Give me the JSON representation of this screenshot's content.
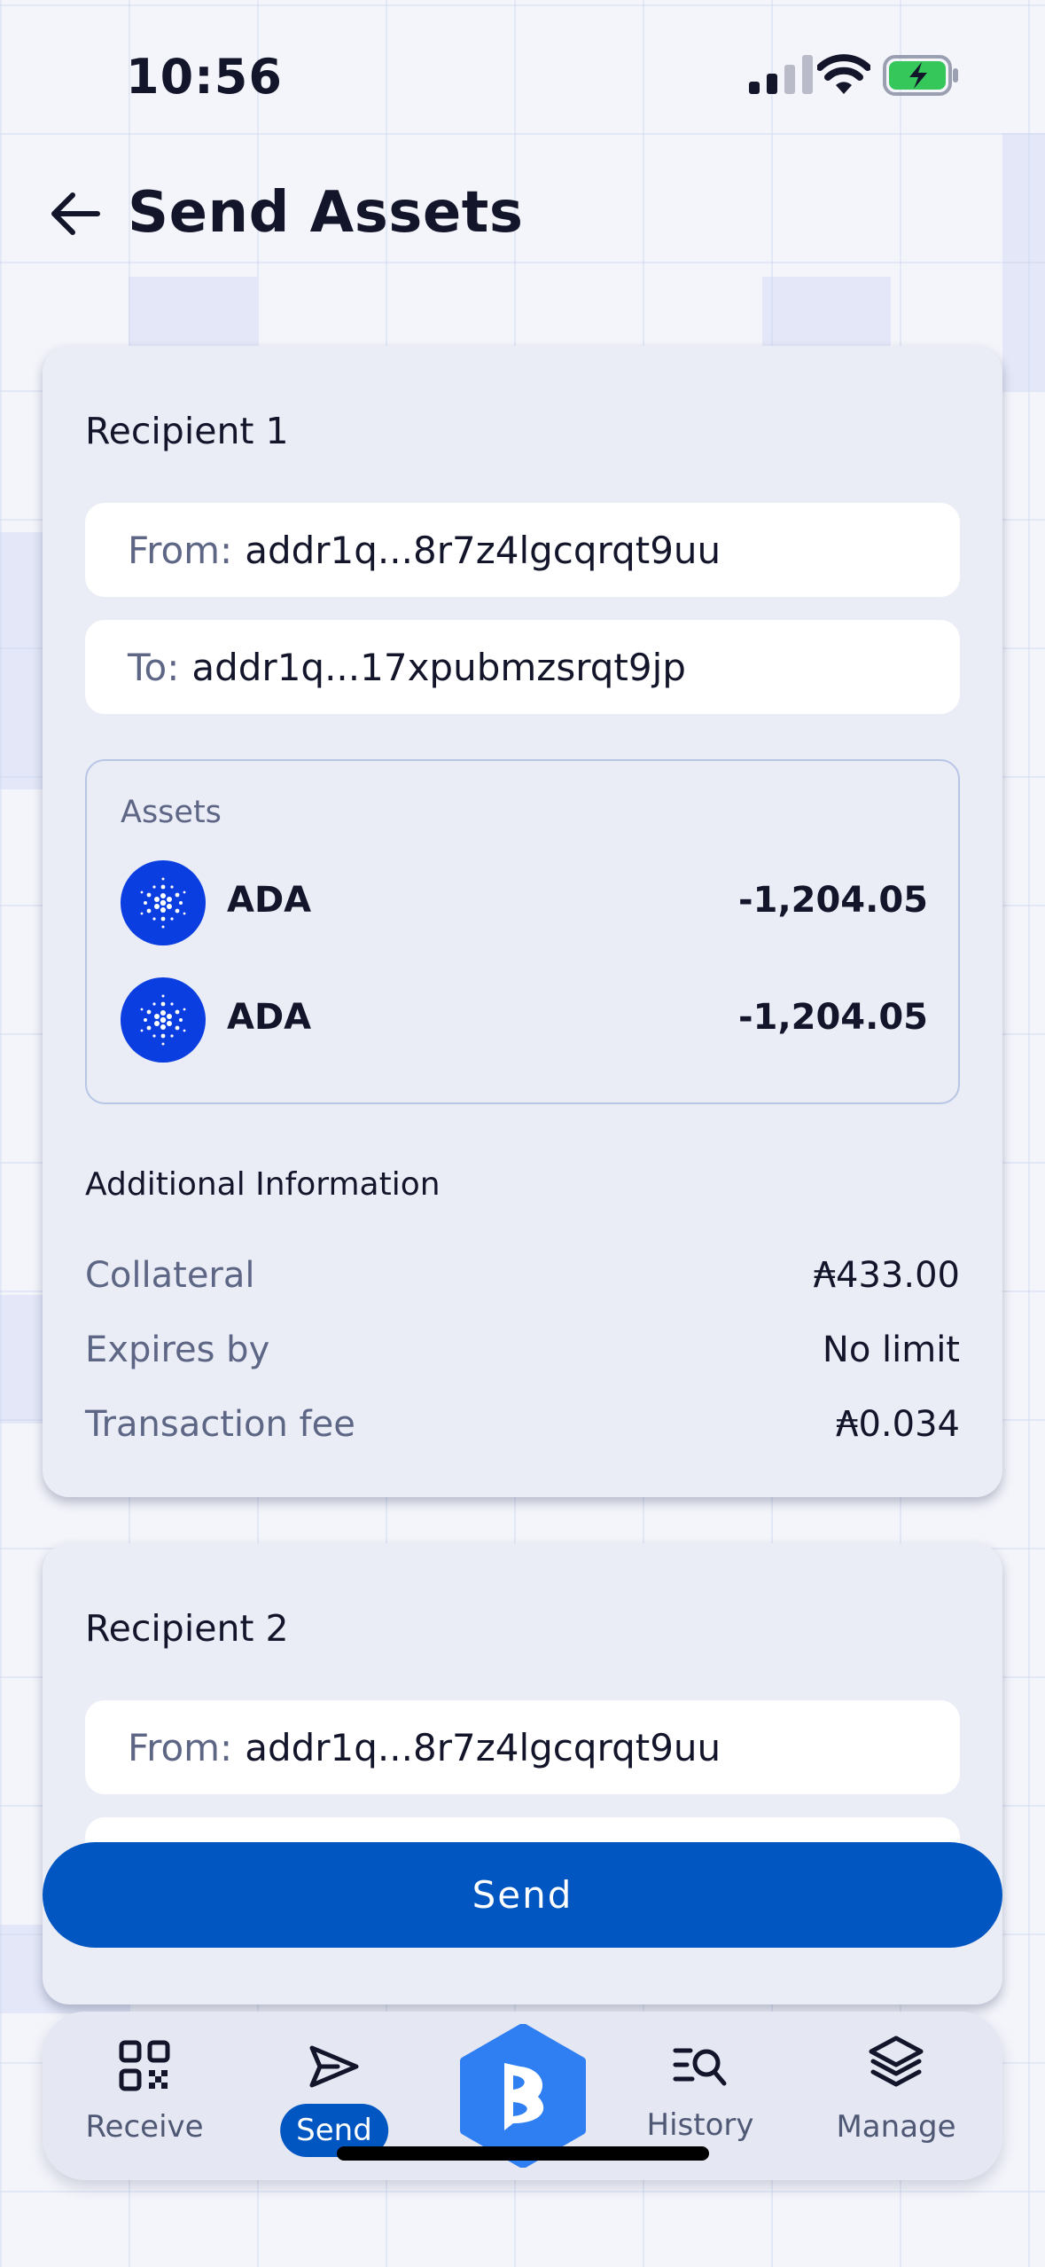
{
  "status_bar": {
    "time": "10:56"
  },
  "header": {
    "title": "Send Assets"
  },
  "recipients": [
    {
      "title": "Recipient 1",
      "from_label": "From:",
      "from_value": "addr1q...8r7z4lgcqrqt9uu",
      "to_label": "To:",
      "to_value": "addr1q...17xpubmzsrqt9jp",
      "assets_title": "Assets",
      "assets": [
        {
          "name": "ADA",
          "amount": "-1,204.05",
          "icon": "cardano-icon"
        },
        {
          "name": "ADA",
          "amount": "-1,204.05",
          "icon": "cardano-icon"
        }
      ],
      "additional_title": "Additional Information",
      "info": [
        {
          "label": "Collateral",
          "value": "₳433.00"
        },
        {
          "label": "Expires by",
          "value": "No limit"
        },
        {
          "label": "Transaction fee",
          "value": "₳0.034"
        }
      ]
    },
    {
      "title": "Recipient 2",
      "from_label": "From:",
      "from_value": "addr1q...8r7z4lgcqrqt9uu"
    }
  ],
  "send_button": {
    "label": "Send"
  },
  "tabbar": {
    "receive": "Receive",
    "send": "Send",
    "history": "History",
    "manage": "Manage"
  },
  "colors": {
    "primary": "#0156c2",
    "coin": "#0a3ee0",
    "background": "#f4f5fb",
    "card": "#eaecf6"
  }
}
